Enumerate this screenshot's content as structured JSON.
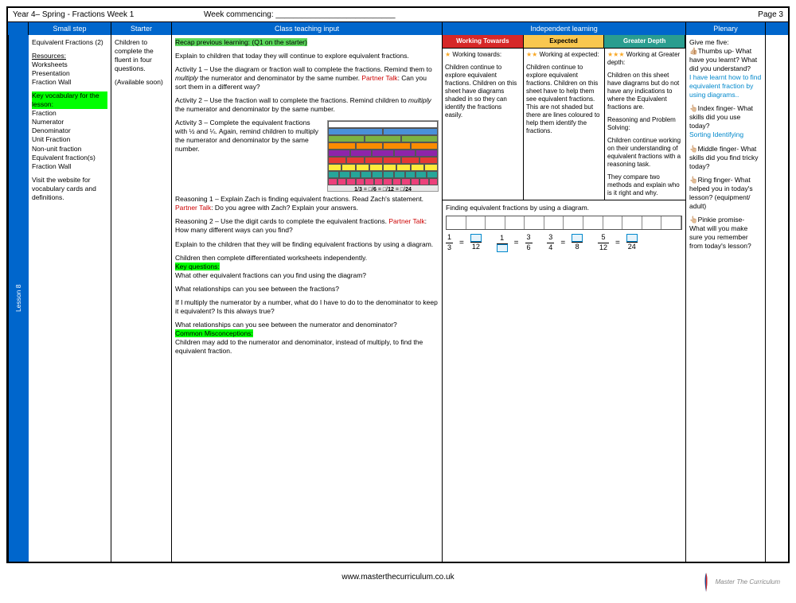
{
  "header": {
    "title": "Year 4– Spring - Fractions Week 1",
    "week": "Week commencing: ___________________________",
    "page": "Page 3"
  },
  "columns": {
    "small": "Small step",
    "starter": "Starter",
    "teaching": "Class teaching input",
    "independent": "Independent learning",
    "plenary": "Plenary"
  },
  "lesson": "Lesson 8",
  "small_step": {
    "title": "Equivalent Fractions (2)",
    "resources_h": "Resources:",
    "resources": "Worksheets\nPresentation\nFraction Wall",
    "vocab_h": "Key vocabulary for the lesson:",
    "vocab": "Fraction\nNumerator\nDenominator\nUnit Fraction\nNon-unit fraction\nEquivalent fraction(s)\nFraction Wall",
    "visit": "Visit the website for vocabulary cards and definitions."
  },
  "starter": {
    "text": "Children to complete the fluent in four questions.",
    "avail": "(Available soon)"
  },
  "teaching": {
    "recap": "Recap previous learning: (Q1 on the starter)",
    "intro": "Explain to children that today they will continue to explore equivalent fractions.",
    "a1a": "Activity 1 – Use the diagram or fraction wall to complete the fractions. Remind them to ",
    "a1b": "multiply",
    "a1c": " the numerator and denominator by the same number. ",
    "pt": "Partner Talk",
    "a1d": ": Can you sort them in a different way?",
    "a2a": "Activity 2 – Use the fraction wall to complete the fractions. Remind children to ",
    "a2b": "multiply",
    "a2c": " the numerator and denominator by the same number.",
    "a3": "Activity 3 – Complete the equivalent fractions with ½ and ¼. Again, remind children to multiply the numerator and denominator by the same number.",
    "r1a": "Reasoning 1 – Explain Zach is finding equivalent fractions. Read Zach's statement. ",
    "r1b": ": Do you agree with Zach? Explain your answers.",
    "r2a": "Reasoning 2 – Use the digit cards to complete the equivalent fractions. ",
    "r2b": ": How many different ways can you find?",
    "explain": "Explain to the children that they will be finding equivalent fractions by using a diagram.",
    "diff": "Children then complete differentiated worksheets independently.",
    "kq_h": "Key questions:",
    "kq1": "What other equivalent fractions can you find using the diagram?",
    "kq2": "What relationships can you see between the fractions?",
    "kq3": "If I multiply the numerator by a number, what do I have to do to the denominator to keep it equivalent? Is this always true?",
    "kq4": "What relationships can you see between the numerator and denominator?",
    "cm_h": "Common Misconceptions:",
    "cm": "Children may add to the numerator and denominator, instead of multiply, to find the equivalent fraction."
  },
  "independent": {
    "wt_h": "Working Towards",
    "exp_h": "Expected",
    "gd_h": "Greater Depth",
    "wt_lead": "Working towards:",
    "wt": "Children continue to explore equivalent fractions. Children on this sheet have diagrams shaded in so they can identify the fractions easily.",
    "exp_lead": "Working at expected:",
    "exp": "Children continue to explore equivalent fractions. Children on this sheet have to help them see equivalent fractions. This are not shaded but there are lines coloured to help them identify the fractions.",
    "gd_lead": "Working at Greater depth:",
    "gd1": "Children on this sheet have diagrams but do not have any indications to where the Equivalent fractions are.",
    "gd2": "Reasoning and Problem Solving:",
    "gd3": "Children continue working on their understanding of equivalent fractions with a reasoning task.",
    "gd4": "They compare two methods and explain who is it right and why.",
    "bottom": "Finding equivalent fractions by using a diagram.",
    "f1n": "1",
    "f1d": "3",
    "f1d2": "12",
    "f2n": "1",
    "f2n2": "3",
    "f2d2": "6",
    "f3n": "3",
    "f3d": "4",
    "f3d2": "8",
    "f4n": "5",
    "f4d": "12",
    "f4d2": "24"
  },
  "plenary": {
    "intro": "Give me five:",
    "thumb": "👍🏼Thumbs up- What have you learnt? What did you understand?",
    "thumb_ans": "I have learnt how to find equivalent fraction by using diagrams..",
    "index": "👆🏼Index finger- What skills did you use today?",
    "index_ans": "Sorting Identifying",
    "middle": "👆🏼Middle finger- What skills did you find tricky today?",
    "ring": "👆🏼Ring finger- What helped you in today's lesson? (equipment/ adult)",
    "pinkie": "👆🏼Pinkie promise- What will you make sure you remember from today's lesson?"
  },
  "footer": "www.masterthecurriculum.co.uk",
  "logo": "Master The Curriculum"
}
